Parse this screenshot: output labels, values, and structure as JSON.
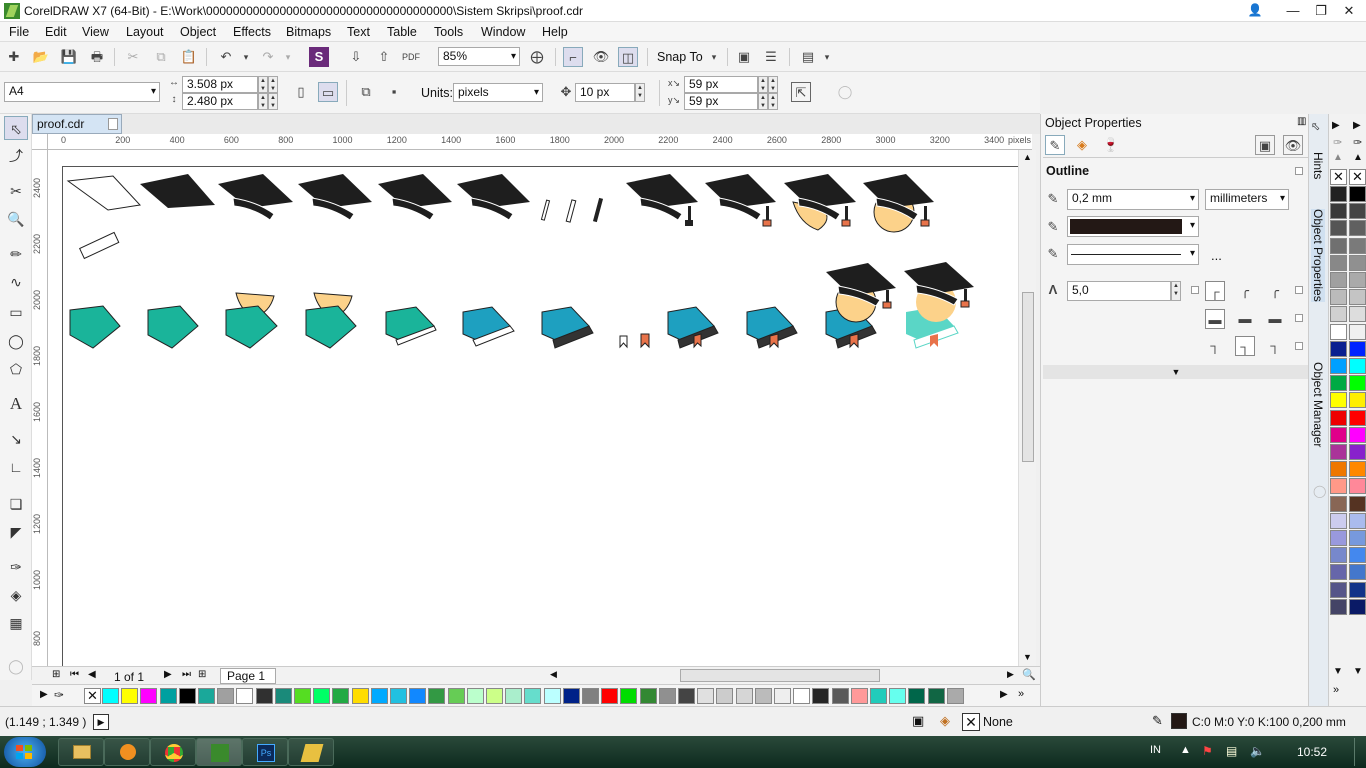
{
  "window": {
    "title": "CorelDRAW X7 (64-Bit) - E:\\Work\\0000000000000000000000000000000000000\\Sistem Skripsi\\proof.cdr"
  },
  "menu": [
    "File",
    "Edit",
    "View",
    "Layout",
    "Object",
    "Effects",
    "Bitmaps",
    "Text",
    "Table",
    "Tools",
    "Window",
    "Help"
  ],
  "toolbar": {
    "zoom": "85%",
    "snap_to": "Snap To"
  },
  "property_bar": {
    "page_size": "A4",
    "width": "3.508 px",
    "height": "2.480 px",
    "units_label": "Units:",
    "units": "pixels",
    "nudge": "10 px",
    "dup_x": "59 px",
    "dup_y": "59 px"
  },
  "document": {
    "tab": "proof.cdr",
    "page_indicator": "1 of 1",
    "page_tab": "Page 1"
  },
  "rulers": {
    "unit": "pixels",
    "h_ticks": [
      "0",
      "200",
      "400",
      "600",
      "800",
      "1000",
      "1200",
      "1400",
      "1600",
      "1800",
      "2000",
      "2200",
      "2400",
      "2600",
      "2800",
      "3000",
      "3200",
      "3400"
    ],
    "v_ticks": [
      "2400",
      "2200",
      "2000",
      "1800",
      "1600",
      "1400",
      "1200",
      "1000",
      "800"
    ]
  },
  "docker": {
    "title": "Object Properties",
    "section": "Outline",
    "outline_width": "0,2 mm",
    "outline_units": "millimeters",
    "outline_color": "#231815",
    "more": "...",
    "miter_limit": "5,0"
  },
  "side_tabs": [
    "Hints",
    "Object Properties",
    "Object Manager"
  ],
  "status": {
    "coords": "(1.149 ; 1.349 )",
    "fill": "None",
    "outline_info": "C:0 M:0 Y:0 K:100 0,200 mm"
  },
  "taskbar": {
    "lang": "IN",
    "time": "10:52"
  },
  "palette_colors": [
    "#00ffff",
    "#ffff00",
    "#ff00ff",
    "#00a0a0",
    "#000000",
    "#1aa89a",
    "#a0a0a0",
    "#ffffff",
    "#303030",
    "#1a8a7a",
    "#55dd22",
    "#00ff66",
    "#22aa44",
    "#ffdd00",
    "#00aaff",
    "#22c0e0",
    "#1188ff",
    "#339944",
    "#66cc55",
    "#bbffcc",
    "#ccff88",
    "#aaeecc",
    "#66ddcc",
    "#bbffff",
    "#002288",
    "#808080",
    "#ff0000",
    "#00dd00",
    "#338833",
    "#909090",
    "#444444",
    "#e0e0e0",
    "#cccccc",
    "#d6d6d6",
    "#bbbbbb",
    "#eeeeee",
    "#ffffff",
    "#252525",
    "#5a5a5a",
    "#ff9999",
    "#22ccbb",
    "#66ffee",
    "#00664a",
    "#116644",
    "#aaaaaa"
  ],
  "right_palette": [
    "#222222",
    "#000000",
    "#3a3a3a",
    "#454545",
    "#555555",
    "#606060",
    "#707070",
    "#7a7a7a",
    "#888888",
    "#909090",
    "#a0a0a0",
    "#aaaaaa",
    "#bbbbbb",
    "#c4c4c4",
    "#d0d0d0",
    "#dddddd",
    "#ffffff",
    "#f0f0f0",
    "#0a2090",
    "#0022ff",
    "#00a0ff",
    "#00ffff",
    "#00aa44",
    "#00ff00",
    "#ffff00",
    "#ffee00",
    "#ee0000",
    "#ff0000",
    "#e0008a",
    "#ff00ff",
    "#aa3399",
    "#8822cc",
    "#ee7700",
    "#ff8800",
    "#ff9988",
    "#ff8899",
    "#886655",
    "#553322",
    "#ccccee",
    "#aabbee",
    "#9999dd",
    "#7799dd",
    "#7788cc",
    "#4488ee",
    "#6666aa",
    "#4477cc",
    "#555588",
    "#113388",
    "#444466",
    "#0a1a66"
  ]
}
